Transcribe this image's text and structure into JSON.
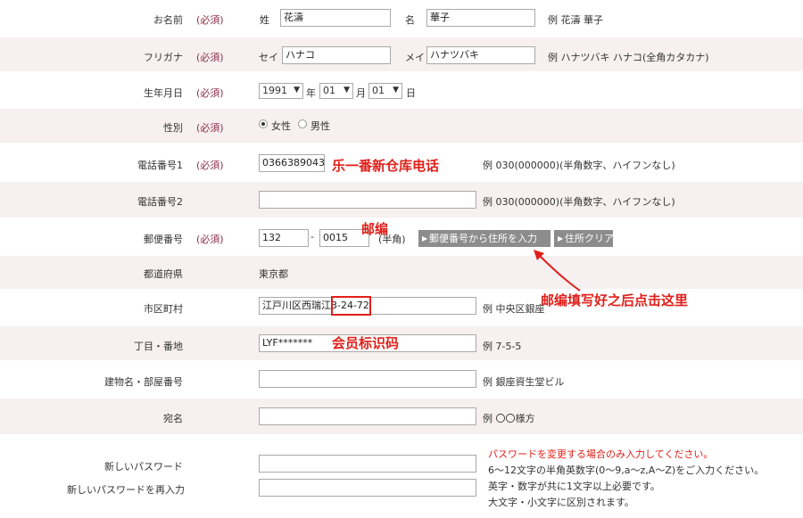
{
  "name": {
    "label": "お名前",
    "required": "(必須)",
    "sei_label": "姓",
    "sei_value": "花濤",
    "mei_label": "名",
    "mei_value": "華子",
    "example": "例 花濤 華子"
  },
  "kana": {
    "label": "フリガナ",
    "required": "(必須)",
    "sei_label": "セイ",
    "sei_value": "ハナコ",
    "mei_label": "メイ",
    "mei_value": "ハナツバキ",
    "example": "例 ハナツバキ ハナコ(全角カタカナ)"
  },
  "birth": {
    "label": "生年月日",
    "required": "(必須)",
    "year": "1991",
    "year_unit": "年",
    "month": "01",
    "month_unit": "月",
    "day": "01",
    "day_unit": "日"
  },
  "gender": {
    "label": "性別",
    "required": "(必須)",
    "female": "女性",
    "male": "男性"
  },
  "phone1": {
    "label": "電話番号1",
    "required": "(必須)",
    "value": "0366389043",
    "example": "例 030(000000)(半角数字、ハイフンなし)",
    "annotation": "乐一番新仓库电话"
  },
  "phone2": {
    "label": "電話番号2",
    "value": "",
    "example": "例 030(000000)(半角数字、ハイフンなし)"
  },
  "postal": {
    "label": "郵便番号",
    "required": "(必須)",
    "part1": "132",
    "dash": "-",
    "part2": "0015",
    "note": "(半角)",
    "lookup_button": "郵便番号から住所を入力",
    "clear_button": "住所クリア",
    "annotation_top": "邮编",
    "annotation_arrow": "邮编填写好之后点击这里"
  },
  "prefecture": {
    "label": "都道府県",
    "value": "東京都"
  },
  "city": {
    "label": "市区町村",
    "value_prefix": "江戸川区西瑞江",
    "value_highlight": "3-24-72",
    "example": "例 中央区銀座"
  },
  "block": {
    "label": "丁目・番地",
    "value": "LYF*******",
    "example": "例 7-5-5",
    "annotation": "会员标识码"
  },
  "building": {
    "label": "建物名・部屋番号",
    "value": "",
    "example": "例 銀座資生堂ビル"
  },
  "addressee": {
    "label": "宛名",
    "value": "",
    "example": "例 〇〇様方"
  },
  "password": {
    "label": "新しいパスワード",
    "confirm_label": "新しいパスワードを再入力",
    "note_red": "パスワードを変更する場合のみ入力してください。",
    "note1": "6～12文字の半角英数字(0～9,a～z,A～Z)をご入力ください。",
    "note2": "英字・数字が共に1文字以上必要です。",
    "note3": "大文字・小文字に区別されます。"
  },
  "colors": {
    "accent": "#8b2f4a",
    "annotation": "#e0201a",
    "row_shade": "#f7f0f0",
    "button": "#8c8c8c"
  }
}
